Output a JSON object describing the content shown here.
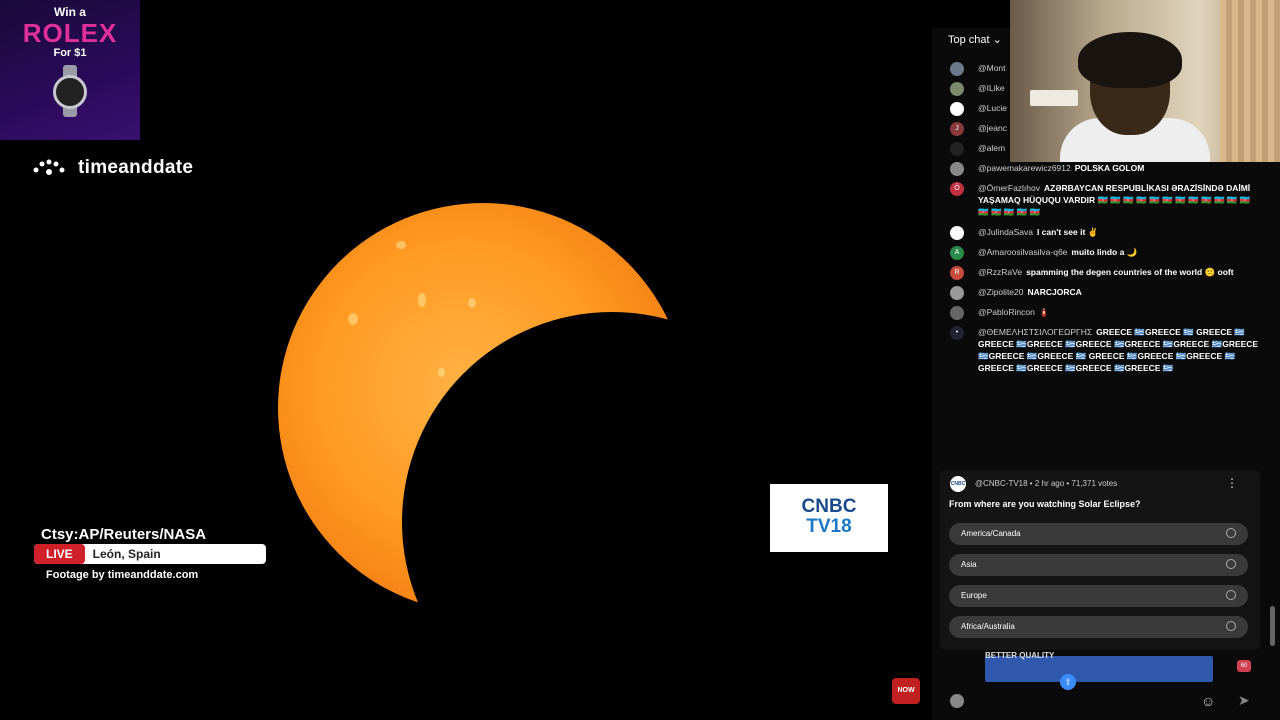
{
  "ad": {
    "line1": "Win a",
    "line2": "ROLEX",
    "line3": "For $1",
    "icon": "watch-icon"
  },
  "logo": {
    "text": "timeanddate",
    "icon": "timeanddate-logo-icon"
  },
  "overlay": {
    "credit": "Ctsy:AP/Reuters/NASA",
    "live": "LIVE",
    "location": "León, Spain",
    "footage": "Footage by timeanddate.com"
  },
  "cnbc": {
    "line1": "CNBC",
    "line2": "TV18"
  },
  "now_badge": "NOW",
  "chat": {
    "mode": "Top chat",
    "messages": [
      {
        "author": "@Mont",
        "text": "",
        "avatar": ""
      },
      {
        "author": "@ILike",
        "text": "",
        "avatar": ""
      },
      {
        "author": "@Lucie",
        "text": "",
        "avatar": ""
      },
      {
        "author": "@jeanc",
        "text": "",
        "avatar": "J"
      },
      {
        "author": "@alem",
        "text": "",
        "avatar": ""
      },
      {
        "author": "@pawemakarewicz6912",
        "text": "POLSKA GOLOM",
        "avatar": ""
      },
      {
        "author": "@ÖmerFazlıhov",
        "text": "AZƏRBAYCAN RESPUBLİKASI ƏRAZİSİNDƏ DAİMİ YAŞAMAQ HÜQUQU VARDIR 🇦🇿 🇦🇿 🇦🇿 🇦🇿 🇦🇿 🇦🇿 🇦🇿 🇦🇿 🇦🇿 🇦🇿 🇦🇿 🇦🇿 🇦🇿 🇦🇿 🇦🇿 🇦🇿 🇦🇿",
        "avatar": "Ö"
      },
      {
        "author": "@JulindaSava",
        "text": "I can't see it ✌",
        "avatar": ""
      },
      {
        "author": "@Amaroosilvasilva-q6e",
        "text": "muito lindo a 🌙",
        "avatar": "A"
      },
      {
        "author": "@RzzRaVe",
        "text": "spamming the degen countries of the world 😕 ooft",
        "avatar": "R"
      },
      {
        "author": "@Zipolite20",
        "text": "NARCJORCA",
        "avatar": ""
      },
      {
        "author": "@PabloRincon",
        "text": "🧯",
        "avatar": ""
      },
      {
        "author": "@ΘΕΜΕΛΗΣΤΣΙΛΟΓΕΩΡΓΗΣ",
        "text": "GREECE 🇬🇷GREECE 🇬🇷 GREECE 🇬🇷GREECE 🇬🇷GREECE 🇬🇷GREECE 🇬🇷GREECE 🇬🇷GREECE 🇬🇷GREECE 🇬🇷GREECE 🇬🇷GREECE 🇬🇷 GREECE 🇬🇷GREECE 🇬🇷GREECE 🇬🇷GREECE 🇬🇷GREECE 🇬🇷GREECE 🇬🇷GREECE 🇬🇷",
        "avatar": "•"
      }
    ],
    "poll": {
      "header": "@CNBC-TV18 • 2 hr ago • 71,371 votes",
      "question": "From where are you watching Solar Eclipse?",
      "options": [
        "America/Canada",
        "Asia",
        "Europe",
        "Africa/Australia"
      ]
    },
    "input_text": "BETTER QUALITY",
    "counter": "60"
  },
  "colors": {
    "live": "#d0202a",
    "sun": "#ff9a22",
    "cnbc": "#1a4a8a"
  }
}
